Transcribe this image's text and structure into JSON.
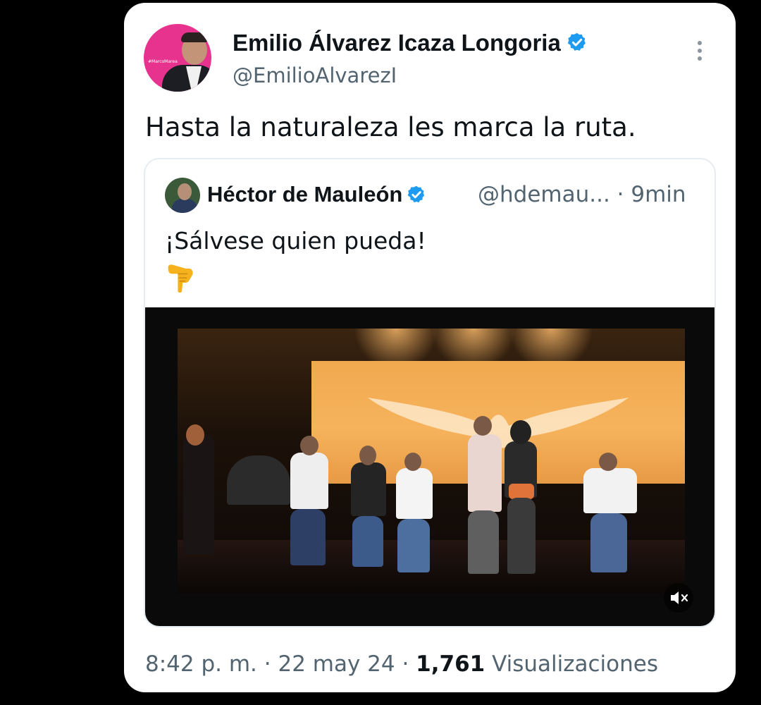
{
  "author": {
    "name": "Emilio Álvarez Icaza Longoria",
    "handle": "@EmilioAlvarezI",
    "verified": true,
    "avatar_tag": "#MarcoMarea"
  },
  "tweet": {
    "text": "Hasta la naturaleza les marca la ruta."
  },
  "quoted": {
    "name": "Héctor de Mauleón",
    "handle_time": "@hdemau... · 9min",
    "verified": true,
    "text": "¡Sálvese quien pueda!",
    "emoji": "backhand-index-pointing-down"
  },
  "video": {
    "muted": true
  },
  "meta": {
    "time": "8:42 p. m. · 22 may 24 · ",
    "views_count": "1,761",
    "views_label": " Visualizaciones"
  },
  "colors": {
    "accent": "#1d9bf0",
    "text_primary": "#0f1419",
    "text_secondary": "#536471",
    "avatar_bg": "#e8338e"
  }
}
